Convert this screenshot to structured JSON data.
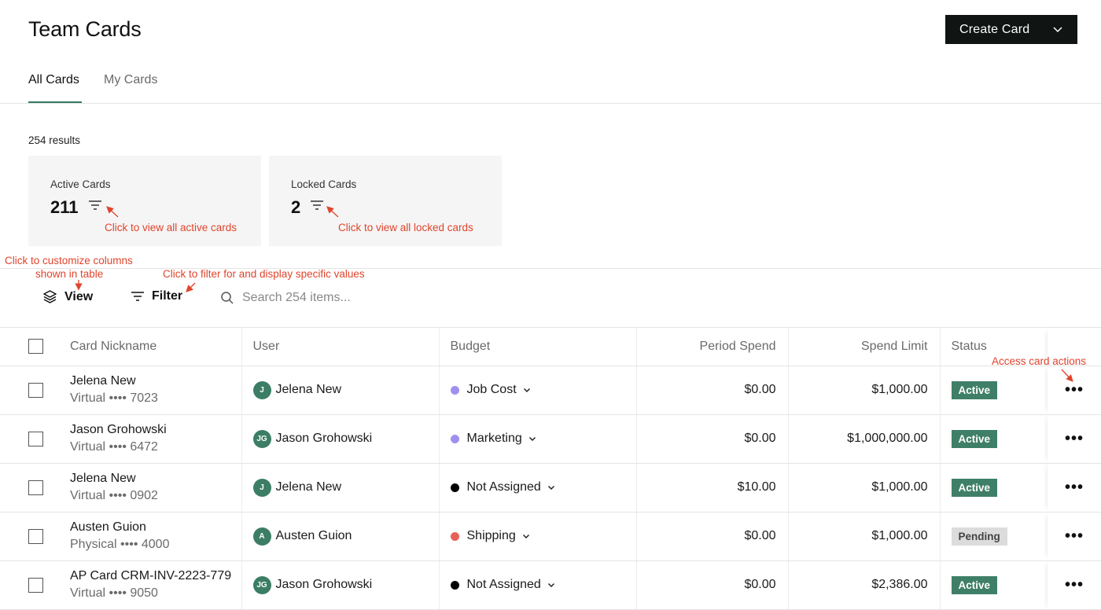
{
  "header": {
    "title": "Team Cards",
    "create_button": "Create Card"
  },
  "tabs": [
    {
      "label": "All Cards",
      "active": true
    },
    {
      "label": "My Cards",
      "active": false
    }
  ],
  "results_text": "254 results",
  "stats": [
    {
      "label": "Active Cards",
      "value": "211"
    },
    {
      "label": "Locked Cards",
      "value": "2"
    }
  ],
  "annotations": {
    "active_cards": "Click to view all active cards",
    "locked_cards": "Click to view all locked cards",
    "view_line1": "Click to customize columns",
    "view_line2": "shown in table",
    "filter": "Click to filter for and display specific values",
    "actions": "Access card actions"
  },
  "toolbar": {
    "view_label": "View",
    "filter_label": "Filter",
    "search_placeholder": "Search 254 items..."
  },
  "table": {
    "columns": [
      "Card Nickname",
      "User",
      "Budget",
      "Period Spend",
      "Spend Limit",
      "Status"
    ],
    "rows": [
      {
        "name": "Jelena New",
        "sub": "Virtual •••• 7023",
        "initials": "J",
        "user": "Jelena New",
        "budget": "Job Cost",
        "budget_color": "#a18ff0",
        "period": "$0.00",
        "limit": "$1,000.00",
        "status": "Active"
      },
      {
        "name": "Jason Grohowski",
        "sub": "Virtual •••• 6472",
        "initials": "JG",
        "user": "Jason Grohowski",
        "budget": "Marketing",
        "budget_color": "#a18ff0",
        "period": "$0.00",
        "limit": "$1,000,000.00",
        "status": "Active"
      },
      {
        "name": "Jelena New",
        "sub": "Virtual •••• 0902",
        "initials": "J",
        "user": "Jelena New",
        "budget": "Not Assigned",
        "budget_color": "#000000",
        "period": "$10.00",
        "limit": "$1,000.00",
        "status": "Active"
      },
      {
        "name": "Austen Guion",
        "sub": "Physical •••• 4000",
        "initials": "A",
        "user": "Austen Guion",
        "budget": "Shipping",
        "budget_color": "#e8605a",
        "period": "$0.00",
        "limit": "$1,000.00",
        "status": "Pending"
      },
      {
        "name": "AP Card CRM-INV-2223-779",
        "sub": "Virtual •••• 9050",
        "initials": "JG",
        "user": "Jason Grohowski",
        "budget": "Not Assigned",
        "budget_color": "#000000",
        "period": "$0.00",
        "limit": "$2,386.00",
        "status": "Active"
      }
    ]
  }
}
